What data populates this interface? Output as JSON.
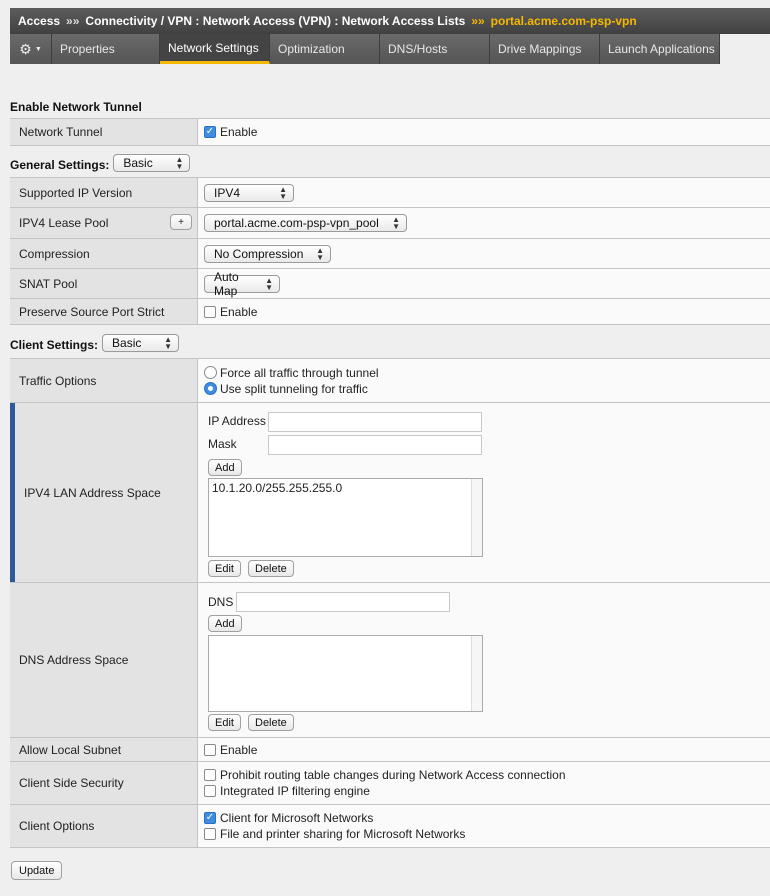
{
  "breadcrumb": {
    "items": [
      "Access",
      "Connectivity / VPN : Network Access (VPN) : Network Access Lists"
    ],
    "separator": "»»",
    "current": "portal.acme.com-psp-vpn"
  },
  "tabs": [
    {
      "label": "Properties",
      "active": false
    },
    {
      "label": "Network Settings",
      "active": true
    },
    {
      "label": "Optimization",
      "active": false
    },
    {
      "label": "DNS/Hosts",
      "active": false
    },
    {
      "label": "Drive Mappings",
      "active": false
    },
    {
      "label": "Launch Applications",
      "active": false
    }
  ],
  "enable_tunnel": {
    "title": "Enable Network Tunnel",
    "label": "Network Tunnel",
    "checkbox_label": "Enable",
    "checked": true
  },
  "general": {
    "title": "General Settings:",
    "mode": "Basic",
    "rows": {
      "ip_version": {
        "label": "Supported IP Version",
        "value": "IPV4"
      },
      "lease_pool": {
        "label": "IPV4 Lease Pool",
        "value": "portal.acme.com-psp-vpn_pool",
        "plus": "+"
      },
      "compression": {
        "label": "Compression",
        "value": "No Compression"
      },
      "snat": {
        "label": "SNAT Pool",
        "value": "Auto Map"
      },
      "preserve": {
        "label": "Preserve Source Port Strict",
        "checkbox_label": "Enable",
        "checked": false
      }
    }
  },
  "client": {
    "title": "Client Settings:",
    "mode": "Basic",
    "traffic": {
      "label": "Traffic Options",
      "options": [
        "Force all traffic through tunnel",
        "Use split tunneling for traffic"
      ],
      "selected": 1
    },
    "lan": {
      "label": "IPV4 LAN Address Space",
      "ip_label": "IP Address",
      "mask_label": "Mask",
      "ip_value": "",
      "mask_value": "",
      "add": "Add",
      "entries": [
        "10.1.20.0/255.255.255.0"
      ],
      "edit": "Edit",
      "delete": "Delete"
    },
    "dns": {
      "label": "DNS Address Space",
      "dns_label": "DNS",
      "dns_value": "",
      "add": "Add",
      "edit": "Edit",
      "delete": "Delete"
    },
    "local_subnet": {
      "label": "Allow Local Subnet",
      "checkbox_label": "Enable",
      "checked": false
    },
    "security": {
      "label": "Client Side Security",
      "options": [
        {
          "text": "Prohibit routing table changes during Network Access connection",
          "checked": false
        },
        {
          "text": "Integrated IP filtering engine",
          "checked": false
        }
      ]
    },
    "options": {
      "label": "Client Options",
      "options": [
        {
          "text": "Client for Microsoft Networks",
          "checked": true
        },
        {
          "text": "File and printer sharing for Microsoft Networks",
          "checked": false
        }
      ]
    }
  },
  "footer": {
    "update": "Update"
  },
  "colors": {
    "accent": "#f5b800",
    "check": "#3f8de0",
    "marker": "#2b5b9b"
  }
}
